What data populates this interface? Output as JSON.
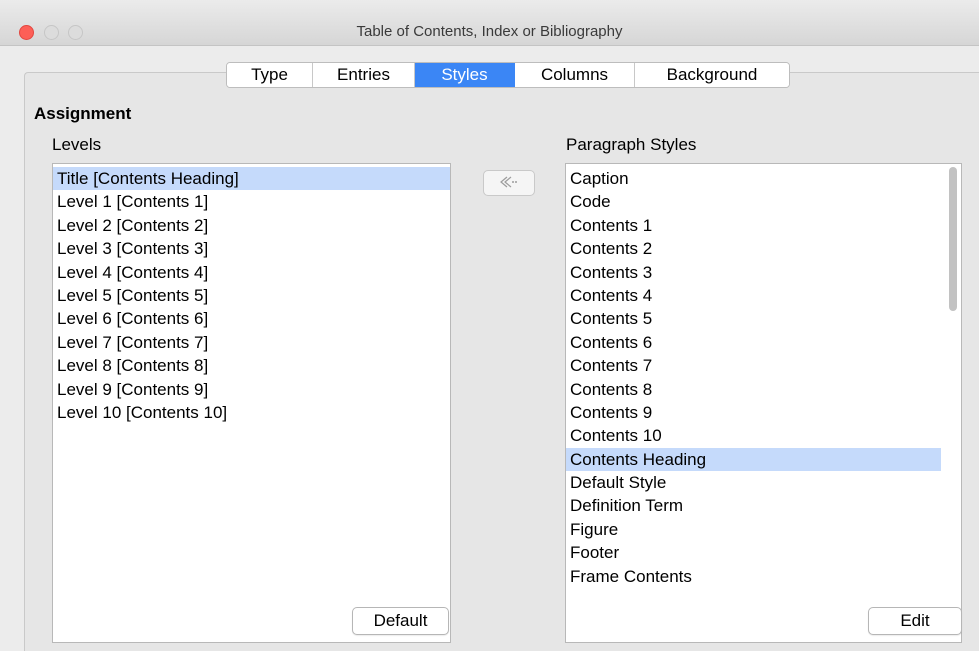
{
  "window": {
    "title": "Table of Contents, Index or Bibliography"
  },
  "tabs": [
    {
      "label": "Type",
      "active": false
    },
    {
      "label": "Entries",
      "active": false
    },
    {
      "label": "Styles",
      "active": true
    },
    {
      "label": "Columns",
      "active": false
    },
    {
      "label": "Background",
      "active": false
    }
  ],
  "assignment": {
    "heading": "Assignment",
    "levels_label": "Levels",
    "paragraph_styles_label": "Paragraph Styles",
    "levels": [
      "Title [Contents Heading]",
      "Level 1 [Contents 1]",
      "Level 2 [Contents 2]",
      "Level 3 [Contents 3]",
      "Level 4 [Contents 4]",
      "Level 5 [Contents 5]",
      "Level 6 [Contents 6]",
      "Level 7 [Contents 7]",
      "Level 8 [Contents 8]",
      "Level 9 [Contents 9]",
      "Level 10 [Contents 10]"
    ],
    "selected_level": "Title [Contents Heading]",
    "paragraph_styles": [
      "Caption",
      "Code",
      "Contents 1",
      "Contents 2",
      "Contents 3",
      "Contents 4",
      "Contents 5",
      "Contents 6",
      "Contents 7",
      "Contents 8",
      "Contents 9",
      "Contents 10",
      "Contents Heading",
      "Default Style",
      "Definition Term",
      "Figure",
      "Footer",
      "Frame Contents"
    ],
    "selected_style": "Contents Heading",
    "assign_icon": "double-chevron-left-icon"
  },
  "buttons": {
    "default_label": "Default",
    "edit_label": "Edit"
  },
  "colors": {
    "active_tab": "#3b86f5",
    "selection": "#c5dafb",
    "close_button": "#fd5f57"
  }
}
